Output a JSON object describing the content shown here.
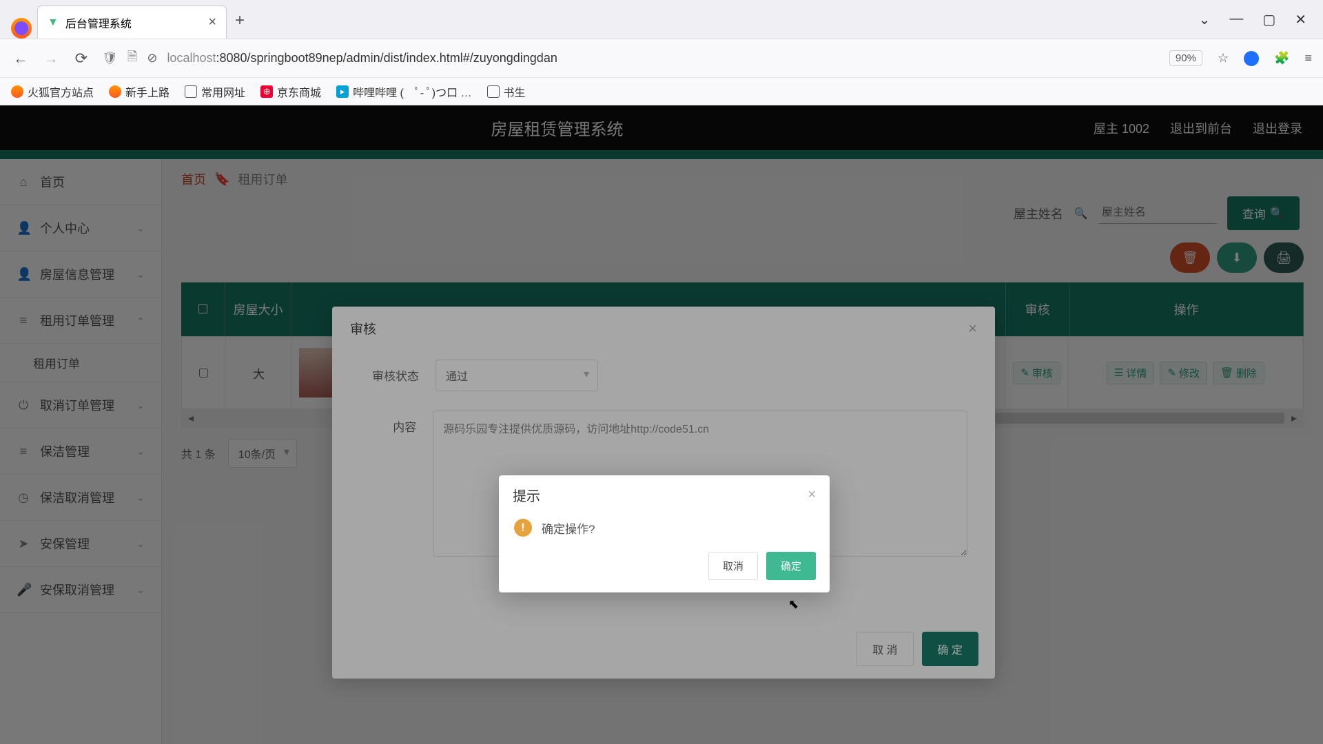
{
  "browser": {
    "tab_title": "后台管理系统",
    "url_host": "localhost",
    "url_port_path": ":8080/springboot89nep/admin/dist/index.html#/zuyongdingdan",
    "zoom": "90%",
    "bookmarks": [
      "火狐官方站点",
      "新手上路",
      "常用网址",
      "京东商城",
      "哔哩哔哩 (　ﾟ- ﾟ)つ口 …",
      "书生"
    ]
  },
  "header": {
    "title": "房屋租赁管理系统",
    "user": "屋主 1002",
    "front": "退出到前台",
    "logout": "退出登录"
  },
  "sidebar": {
    "home": "首页",
    "items": [
      {
        "label": "个人中心"
      },
      {
        "label": "房屋信息管理"
      },
      {
        "label": "租用订单管理",
        "expanded": true,
        "sub": "租用订单"
      },
      {
        "label": "取消订单管理"
      },
      {
        "label": "保洁管理"
      },
      {
        "label": "保洁取消管理"
      },
      {
        "label": "安保管理"
      },
      {
        "label": "安保取消管理"
      }
    ]
  },
  "crumbs": {
    "home": "首页",
    "current": "租用订单"
  },
  "search": {
    "label": "屋主姓名",
    "placeholder": "屋主姓名",
    "btn": "查询"
  },
  "table": {
    "headers": [
      "房屋大小",
      "审核",
      "操作"
    ],
    "row": {
      "size": "大",
      "audit_btn": "审核",
      "detail": "详情",
      "edit": "修改",
      "del": "删除"
    }
  },
  "pager": {
    "total": "共 1 条",
    "per": "10条/页"
  },
  "audit_dialog": {
    "title": "审核",
    "status_label": "审核状态",
    "status_value": "通过",
    "content_label": "内容",
    "content_value": "源码乐园专注提供优质源码，访问地址http://code51.cn",
    "cancel": "取 消",
    "ok": "确 定"
  },
  "confirm": {
    "title": "提示",
    "message": "确定操作?",
    "cancel": "取消",
    "ok": "确定"
  }
}
